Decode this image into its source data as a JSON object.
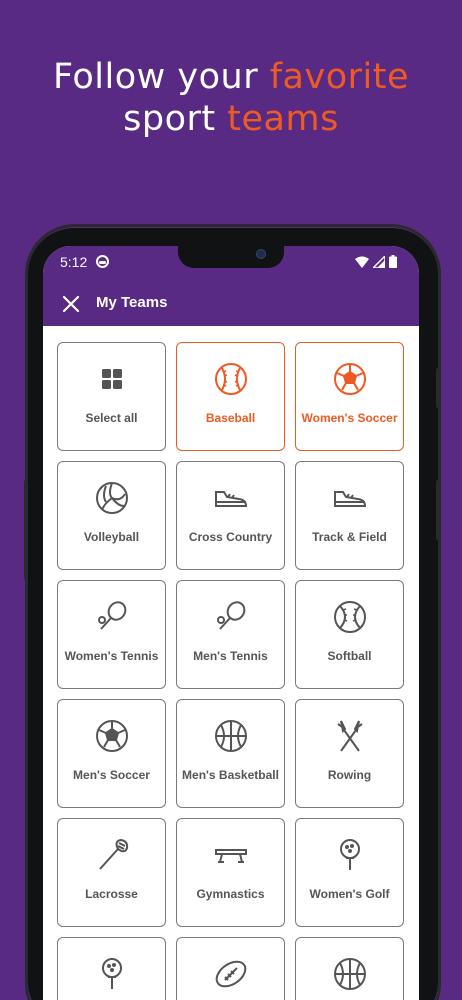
{
  "headline": {
    "line1_plain": "Follow your ",
    "line1_accent": "favorite",
    "line2_plain": "sport ",
    "line2_accent": "teams"
  },
  "status_bar": {
    "time": "5:12"
  },
  "app_bar": {
    "title": "My Teams"
  },
  "colors": {
    "brand": "#582a84",
    "accent": "#ee5a24",
    "text": "#555555",
    "border": "#7a7a7a"
  },
  "teams": [
    {
      "label": "Select all",
      "icon": "grid-icon",
      "selected": false
    },
    {
      "label": "Baseball",
      "icon": "baseball-icon",
      "selected": true
    },
    {
      "label": "Women's Soccer",
      "icon": "soccer-ball-icon",
      "selected": true
    },
    {
      "label": "Volleyball",
      "icon": "volleyball-icon",
      "selected": false
    },
    {
      "label": "Cross Country",
      "icon": "running-shoe-icon",
      "selected": false
    },
    {
      "label": "Track & Field",
      "icon": "running-shoe-icon",
      "selected": false
    },
    {
      "label": "Women's Tennis",
      "icon": "tennis-racket-icon",
      "selected": false
    },
    {
      "label": "Men's Tennis",
      "icon": "tennis-racket-icon",
      "selected": false
    },
    {
      "label": "Softball",
      "icon": "softball-icon",
      "selected": false
    },
    {
      "label": "Men's Soccer",
      "icon": "soccer-ball-icon",
      "selected": false
    },
    {
      "label": "Men's Basketball",
      "icon": "basketball-icon",
      "selected": false
    },
    {
      "label": "Rowing",
      "icon": "oars-icon",
      "selected": false
    },
    {
      "label": "Lacrosse",
      "icon": "lacrosse-stick-icon",
      "selected": false
    },
    {
      "label": "Gymnastics",
      "icon": "balance-beam-icon",
      "selected": false
    },
    {
      "label": "Women's Golf",
      "icon": "golf-ball-icon",
      "selected": false
    },
    {
      "label": "",
      "icon": "golf-ball-icon",
      "selected": false
    },
    {
      "label": "",
      "icon": "football-icon",
      "selected": false
    },
    {
      "label": "",
      "icon": "basketball-icon",
      "selected": false
    }
  ]
}
